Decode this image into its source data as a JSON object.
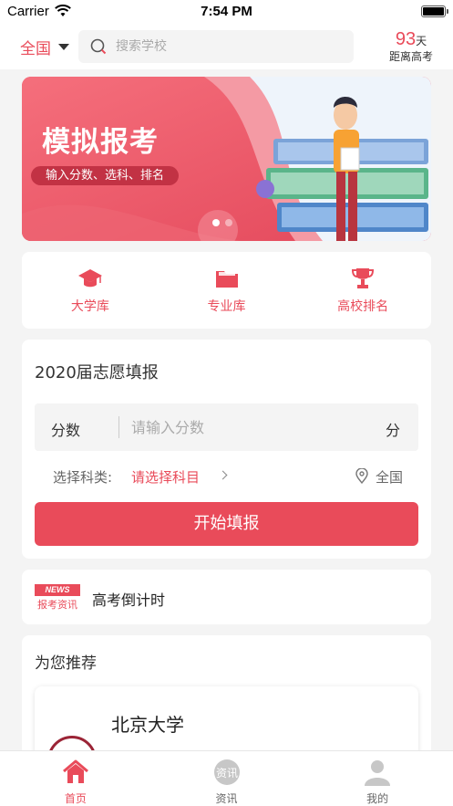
{
  "status_bar": {
    "carrier": "Carrier",
    "time": "7:54 PM"
  },
  "header": {
    "region": "全国",
    "search_placeholder": "搜索学校",
    "countdown_days": "93",
    "countdown_unit": "天",
    "countdown_label": "距离高考"
  },
  "banner": {
    "title": "模拟报考",
    "subtitle": "输入分数、选科、排名",
    "active_slide": 1,
    "slide_count": 2
  },
  "quick_links": [
    {
      "label": "大学库",
      "icon": "graduation-cap-icon"
    },
    {
      "label": "专业库",
      "icon": "folder-icon"
    },
    {
      "label": "高校排名",
      "icon": "trophy-icon"
    }
  ],
  "form": {
    "title": "2020届志愿填报",
    "score_label": "分数",
    "score_placeholder": "请输入分数",
    "score_unit": "分",
    "subject_label": "选择科类:",
    "subject_value": "请选择科目",
    "region_value": "全国",
    "submit_label": "开始填报"
  },
  "news": {
    "badge_top": "NEWS",
    "badge_bottom": "报考资讯",
    "text": "高考倒计时"
  },
  "recommend": {
    "title": "为您推荐",
    "school_name": "北京大学"
  },
  "tabbar": [
    {
      "label": "首页",
      "icon": "home-icon",
      "active": true
    },
    {
      "label": "资讯",
      "icon": "news-icon",
      "active": false
    },
    {
      "label": "我的",
      "icon": "profile-icon",
      "active": false
    }
  ],
  "colors": {
    "accent": "#e94b5a",
    "background": "#f4f4f4"
  }
}
